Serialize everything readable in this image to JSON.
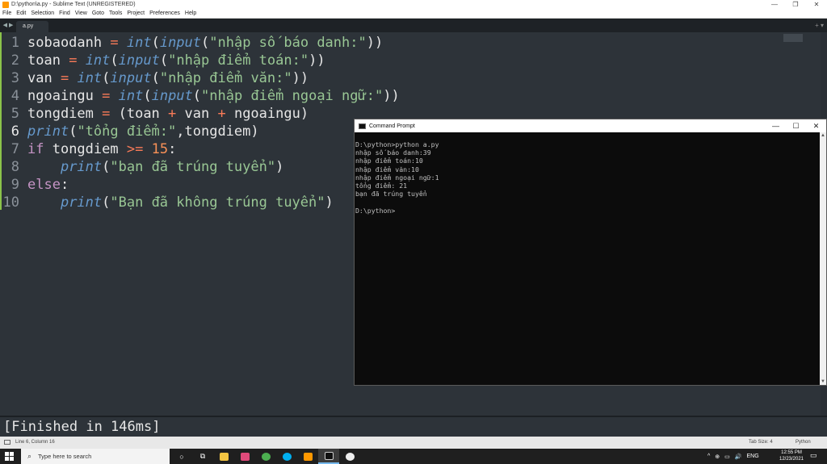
{
  "window": {
    "title": "D:\\python\\a.py - Sublime Text (UNREGISTERED)",
    "controls": [
      "—",
      "❐",
      "✕"
    ]
  },
  "menu": [
    "File",
    "Edit",
    "Selection",
    "Find",
    "View",
    "Goto",
    "Tools",
    "Project",
    "Preferences",
    "Help"
  ],
  "tabs": {
    "nav": "◀ ▶",
    "active": "a.py",
    "right": "+ ▾"
  },
  "code": {
    "active_line": 6,
    "lines": [
      {
        "n": "1",
        "tokens": [
          [
            "txt",
            "sobaodanh "
          ],
          [
            "op",
            "="
          ],
          [
            "txt",
            " "
          ],
          [
            "fn",
            "int"
          ],
          [
            "txt",
            "("
          ],
          [
            "fn",
            "input"
          ],
          [
            "txt",
            "("
          ],
          [
            "str",
            "\"nhập số báo danh:\""
          ],
          [
            "txt",
            "))"
          ]
        ]
      },
      {
        "n": "2",
        "tokens": [
          [
            "txt",
            "toan "
          ],
          [
            "op",
            "="
          ],
          [
            "txt",
            " "
          ],
          [
            "fn",
            "int"
          ],
          [
            "txt",
            "("
          ],
          [
            "fn",
            "input"
          ],
          [
            "txt",
            "("
          ],
          [
            "str",
            "\"nhập điểm toán:\""
          ],
          [
            "txt",
            "))"
          ]
        ]
      },
      {
        "n": "3",
        "tokens": [
          [
            "txt",
            "van "
          ],
          [
            "op",
            "="
          ],
          [
            "txt",
            " "
          ],
          [
            "fn",
            "int"
          ],
          [
            "txt",
            "("
          ],
          [
            "fn",
            "input"
          ],
          [
            "txt",
            "("
          ],
          [
            "str",
            "\"nhập điểm văn:\""
          ],
          [
            "txt",
            "))"
          ]
        ]
      },
      {
        "n": "4",
        "tokens": [
          [
            "txt",
            "ngoaingu "
          ],
          [
            "op",
            "="
          ],
          [
            "txt",
            " "
          ],
          [
            "fn",
            "int"
          ],
          [
            "txt",
            "("
          ],
          [
            "fn",
            "input"
          ],
          [
            "txt",
            "("
          ],
          [
            "str",
            "\"nhập điểm ngoại ngữ:\""
          ],
          [
            "txt",
            "))"
          ]
        ]
      },
      {
        "n": "5",
        "tokens": [
          [
            "txt",
            "tongdiem "
          ],
          [
            "op",
            "="
          ],
          [
            "txt",
            " (toan "
          ],
          [
            "op",
            "+"
          ],
          [
            "txt",
            " van "
          ],
          [
            "op",
            "+"
          ],
          [
            "txt",
            " ngoaingu)"
          ]
        ]
      },
      {
        "n": "6",
        "tokens": [
          [
            "fn",
            "print"
          ],
          [
            "txt",
            "("
          ],
          [
            "str",
            "\"tổng điểm:\""
          ],
          [
            "txt",
            ",tongdiem)"
          ]
        ]
      },
      {
        "n": "7",
        "tokens": [
          [
            "kw",
            "if"
          ],
          [
            "txt",
            " tongdiem "
          ],
          [
            "op",
            ">="
          ],
          [
            "txt",
            " "
          ],
          [
            "num",
            "15"
          ],
          [
            "txt",
            ":"
          ]
        ]
      },
      {
        "n": "8",
        "tokens": [
          [
            "txt",
            "    "
          ],
          [
            "fn",
            "print"
          ],
          [
            "txt",
            "("
          ],
          [
            "str",
            "\"bạn đã trúng tuyển\""
          ],
          [
            "txt",
            ")"
          ]
        ]
      },
      {
        "n": "9",
        "tokens": [
          [
            "kw",
            "else"
          ],
          [
            "txt",
            ":"
          ]
        ]
      },
      {
        "n": "10",
        "tokens": [
          [
            "txt",
            "    "
          ],
          [
            "fn",
            "print"
          ],
          [
            "txt",
            "("
          ],
          [
            "str",
            "\"Bạn đã không trúng tuyển\""
          ],
          [
            "txt",
            ")"
          ]
        ]
      }
    ]
  },
  "cmd": {
    "title": "Command Prompt",
    "controls": [
      "—",
      "☐",
      "✕"
    ],
    "lines": [
      "D:\\python>python a.py",
      "nhập số báo danh:39",
      "nhập điểm toán:10",
      "nhập điểm văn:10",
      "nhập điểm ngoại ngữ:1",
      "tổng điểm: 21",
      "bạn đã trúng tuyển",
      "",
      "D:\\python>"
    ]
  },
  "output": {
    "text": "[Finished in 146ms]"
  },
  "status": {
    "position": "Line 6, Column 16",
    "tab_size": "Tab Size: 4",
    "syntax": "Python"
  },
  "taskbar": {
    "search_placeholder": "Type here to search",
    "tray": [
      "^",
      "⊕",
      "▭",
      "🔊",
      "ENG"
    ],
    "time": "12:55 PM",
    "date": "12/23/2021",
    "notifications": "1"
  },
  "colors": {
    "editor_bg": "#2d3339",
    "keyword": "#c594c5",
    "function": "#6699cc",
    "string": "#99c794",
    "operator": "#f97b58",
    "number": "#f99157"
  }
}
